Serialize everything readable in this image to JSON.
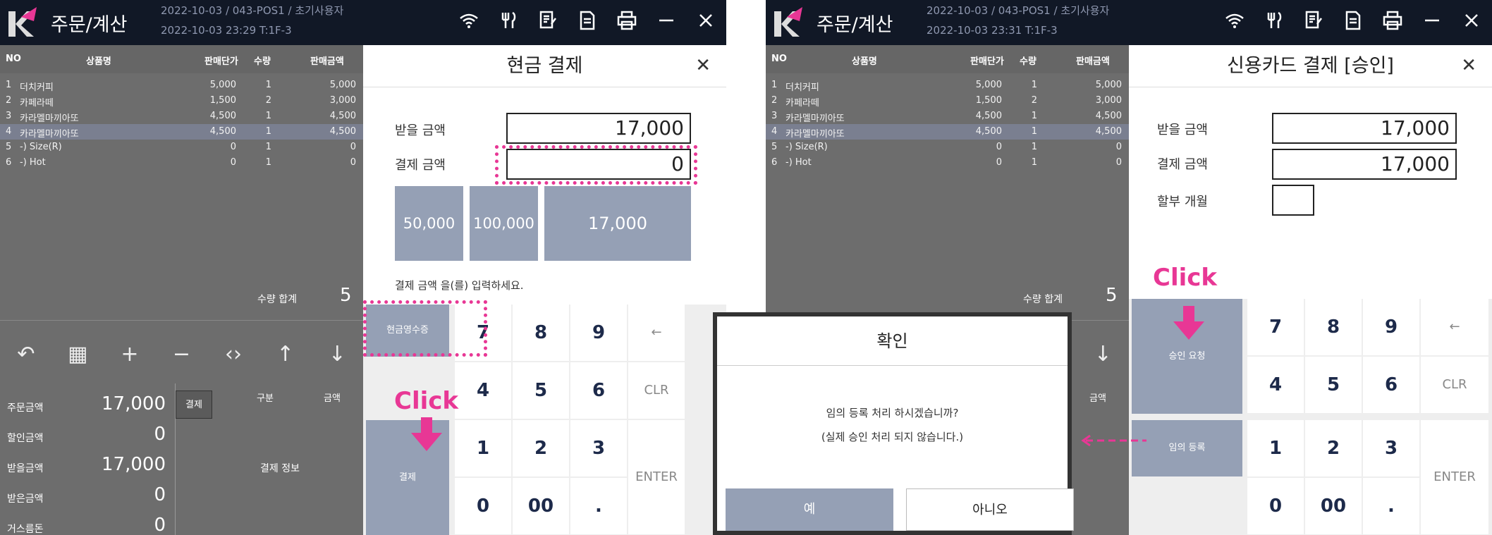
{
  "app": {
    "title": "주문/계산",
    "meta_line1": "2022-10-03 / 043-POS1 / 초기사용자",
    "meta_line2_a": "2022-10-03 23:29   T:1F-3",
    "meta_line2_b": "2022-10-03 23:31   T:1F-3",
    "icons": [
      "wifi-icon",
      "utensils-icon",
      "receipt-icon",
      "document-icon",
      "printer-icon",
      "minimize-icon",
      "close-icon"
    ]
  },
  "order_table": {
    "headers": {
      "no": "NO",
      "name": "상품명",
      "price": "판매단가",
      "qty": "수량",
      "amount": "판매금액"
    },
    "rows": [
      {
        "no": "1",
        "name": "더치커피",
        "price": "5,000",
        "qty": "1",
        "amount": "5,000"
      },
      {
        "no": "2",
        "name": "카페라떼",
        "price": "1,500",
        "qty": "2",
        "amount": "3,000"
      },
      {
        "no": "3",
        "name": "카라멜마끼아또",
        "price": "4,500",
        "qty": "1",
        "amount": "4,500"
      },
      {
        "no": "4",
        "name": "카라멜마끼아또",
        "price": "4,500",
        "qty": "1",
        "amount": "4,500"
      },
      {
        "no": "5",
        "name": "-) Size(R)",
        "price": "0",
        "qty": "1",
        "amount": "0"
      },
      {
        "no": "6",
        "name": "-) Hot",
        "price": "0",
        "qty": "1",
        "amount": "0"
      }
    ],
    "selected_row": 3,
    "qty_total_label": "수량 합계",
    "qty_total": "5"
  },
  "summary": [
    {
      "label": "주문금액",
      "value": "17,000"
    },
    {
      "label": "할인금액",
      "value": "0"
    },
    {
      "label": "받을금액",
      "value": "17,000"
    },
    {
      "label": "받은금액",
      "value": "0"
    },
    {
      "label": "거스름돈",
      "value": "0"
    }
  ],
  "subpanel": {
    "tab": "결제",
    "col1": "구분",
    "col2": "금액",
    "info": "결제 정보"
  },
  "cash_dialog": {
    "title": "현금 결제",
    "receive_label": "받을 금액",
    "receive_value": "17,000",
    "pay_label": "결제 금액",
    "pay_value": "0",
    "quick": [
      "50,000",
      "100,000",
      "17,000"
    ],
    "hint": "결제 금액 을(를) 입력하세요.",
    "receipt_button": "현금영수증",
    "pay_button": "결제"
  },
  "card_dialog": {
    "title": "신용카드 결제 [승인]",
    "receive_label": "받을 금액",
    "receive_value": "17,000",
    "pay_label": "결제 금액",
    "pay_value": "17,000",
    "installment_label": "할부 개월",
    "approve_button": "승인 요청",
    "manual_button": "임의 등록"
  },
  "keypad": {
    "keys": [
      "7",
      "8",
      "9",
      "←",
      "4",
      "5",
      "6",
      "CLR",
      "1",
      "2",
      "3",
      "0",
      "00",
      "."
    ],
    "enter": "ENTER"
  },
  "annotations": {
    "click1": "Click",
    "click2": "Click",
    "color": "#e83795"
  },
  "confirm": {
    "title": "확인",
    "msg1": "임의 등록 처리 하시겠습니까?",
    "msg2": "(실제 승인 처리 되지 않습니다.)",
    "yes": "예",
    "no": "아니오"
  }
}
